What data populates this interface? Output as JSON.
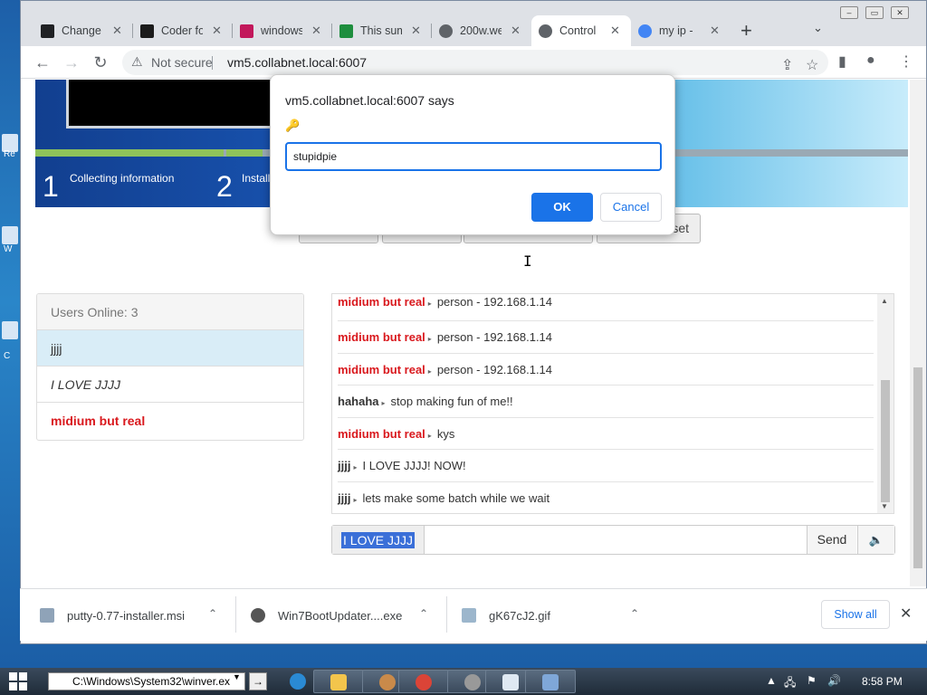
{
  "browser": {
    "tabs": [
      {
        "label": "Change",
        "favicon_color": "#202124"
      },
      {
        "label": "Coder fo",
        "favicon_color": "#1b1b1b"
      },
      {
        "label": "windows",
        "favicon_color": "#c2185b"
      },
      {
        "label": "This sum",
        "favicon_color": "#1e8e3e"
      },
      {
        "label": "200w.we",
        "favicon_color": "#5f6368"
      },
      {
        "label": "Control",
        "favicon_color": "#5f6368",
        "active": true
      },
      {
        "label": "my ip -",
        "favicon_color": "#4285f4"
      }
    ],
    "omnibox": {
      "security_text": "Not secure",
      "url": "vm5.collabnet.local:6007"
    }
  },
  "page": {
    "steps": [
      {
        "number": "1",
        "label": "Collecting information"
      },
      {
        "number": "2",
        "label": "Install"
      }
    ],
    "background_button_partial": "set",
    "users": {
      "header": "Users Online: 3",
      "list": [
        "jjjj",
        "I LOVE JJJJ",
        "midium but real"
      ]
    },
    "chat": {
      "messages": [
        {
          "user": "midium but real",
          "text": "person - 192.168.1.14",
          "color": "#d9181d"
        },
        {
          "user": "midium but real",
          "text": "person - 192.168.1.14",
          "color": "#d9181d"
        },
        {
          "user": "midium but real",
          "text": "person - 192.168.1.14",
          "color": "#d9181d"
        },
        {
          "user": "hahaha",
          "text": "stop making fun of me!!",
          "color": "#333333"
        },
        {
          "user": "midium but real",
          "text": "kys",
          "color": "#d9181d"
        },
        {
          "user": "jjjj",
          "text": "I LOVE JJJJ! NOW!",
          "color": "#333333"
        },
        {
          "user": "jjjj",
          "text": "lets make some batch while we wait",
          "color": "#333333"
        }
      ],
      "input_prefix": "I LOVE JJJJ",
      "send_label": "Send"
    }
  },
  "dialog": {
    "title": "vm5.collabnet.local:6007 says",
    "message": "🔑",
    "input_value": "stupidpie",
    "ok_label": "OK",
    "cancel_label": "Cancel"
  },
  "downloads": {
    "items": [
      {
        "name": "putty-0.77-installer.msi"
      },
      {
        "name": "Win7BootUpdater....exe"
      },
      {
        "name": "gK67cJ2.gif"
      }
    ],
    "show_all_label": "Show all"
  },
  "taskbar": {
    "run_text": "C:\\Windows\\System32\\winver.ex",
    "clock": "8:58 PM"
  },
  "desktop": {
    "icon_labels": [
      "Re",
      "W",
      "C"
    ]
  }
}
